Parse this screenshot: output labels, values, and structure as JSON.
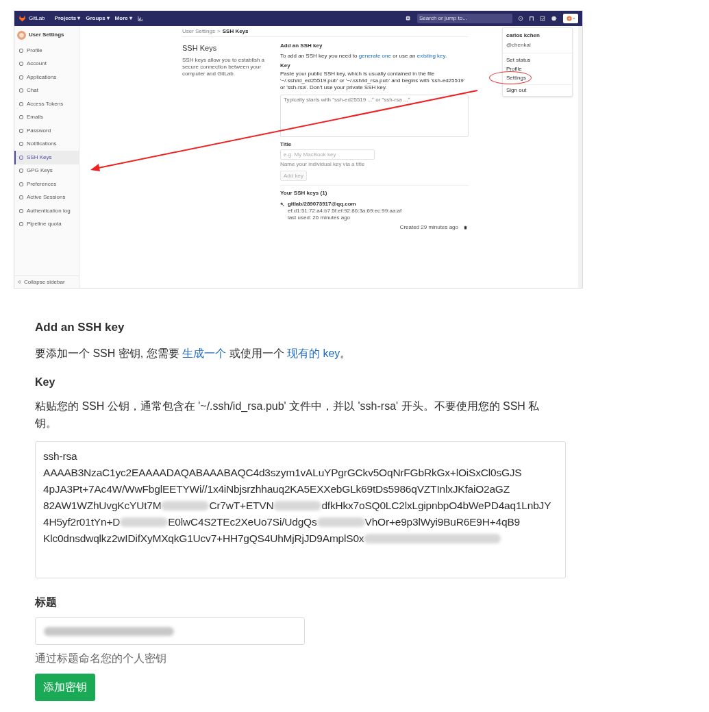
{
  "top_screenshot": {
    "navbar": {
      "brand": "GitLab",
      "menus": [
        {
          "label": "Projects",
          "caret": "▾"
        },
        {
          "label": "Groups",
          "caret": "▾"
        },
        {
          "label": "More",
          "caret": "▾"
        }
      ],
      "search": {
        "placeholder": "Search or jump to..."
      }
    },
    "sidebar": {
      "header": "User Settings",
      "items": [
        {
          "label": "Profile",
          "selected": false
        },
        {
          "label": "Account",
          "selected": false
        },
        {
          "label": "Applications",
          "selected": false
        },
        {
          "label": "Chat",
          "selected": false
        },
        {
          "label": "Access Tokens",
          "selected": false
        },
        {
          "label": "Emails",
          "selected": false
        },
        {
          "label": "Password",
          "selected": false
        },
        {
          "label": "Notifications",
          "selected": false
        },
        {
          "label": "SSH Keys",
          "selected": true
        },
        {
          "label": "GPG Keys",
          "selected": false
        },
        {
          "label": "Preferences",
          "selected": false
        },
        {
          "label": "Active Sessions",
          "selected": false
        },
        {
          "label": "Authentication log",
          "selected": false
        },
        {
          "label": "Pipeline quota",
          "selected": false
        }
      ],
      "collapse": "Collapse sidebar"
    },
    "breadcrumb": [
      "User Settings",
      "SSH Keys"
    ],
    "breadcrumb_separator": ">",
    "page_title": "SSH Keys",
    "page_description": "SSH keys allow you to establish a secure connection between your computer and GitLab.",
    "form": {
      "heading": "Add an SSH key",
      "intro": [
        "To add an SSH key you need to ",
        "generate one",
        " or use an ",
        "existing key",
        "."
      ],
      "key_label": "Key",
      "key_help": "Paste your public SSH key, which is usually contained in the file '~/.ssh/id_ed25519.pub' or '~/.ssh/id_rsa.pub' and begins with 'ssh-ed25519' or 'ssh-rsa'. Don't use your private SSH key.",
      "key_placeholder": "Typically starts with \"ssh-ed25519 ...\" or \"ssh-rsa ...\"",
      "title_label": "Title",
      "title_placeholder": "e.g. My MacBook key",
      "title_help": "Name your individual key via a title",
      "button": "Add key"
    },
    "keys_heading": "Your SSH keys (1)",
    "keys": [
      {
        "name": "gitlab/289073917@qq.com",
        "fingerprint": "ef:d1:51:72:a4:b7:5f:ef:92:86:3a:69:ec:99:aa:af",
        "last_used": "last used: 26 minutes ago",
        "created": "Created 29 minutes ago"
      }
    ],
    "user_menu": {
      "name": "carlos kchen",
      "handle": "@chenkai",
      "items": [
        {
          "label": "Set status",
          "circled": false
        },
        {
          "label": "Profile",
          "circled": false
        },
        {
          "label": "Settings",
          "circled": true
        }
      ],
      "sign_out": "Sign out"
    }
  },
  "bottom_form": {
    "heading": "Add an SSH key",
    "intro": [
      "要添加一个 SSH 密钥, 您需要 ",
      "生成一个",
      " 或使用一个 ",
      "现有的 key",
      "。"
    ],
    "key_label": "Key",
    "key_help": "粘贴您的 SSH 公钥，通常包含在 '~/.ssh/id_rsa.pub' 文件中，并以 'ssh-rsa' 开头。不要使用您的 SSH 私钥。",
    "key_lines": [
      [
        {
          "kind": "text",
          "text": "ssh-rsa"
        }
      ],
      [
        {
          "kind": "text",
          "text": "AAAAB3NzaC1yc2EAAAADAQABAAABAQC4d3szym1vALuYPgrGCkv5OqNrFGbRkGx+lOiSxCl0sGJS"
        }
      ],
      [
        {
          "kind": "text",
          "text": "4pJA3Pt+7Ac4W/WwFbglEETYWi//1x4iNbjsrzhhauq2KA5EXXebGLk69tDs5986qVZTInlxJKfaiO2aGZ"
        }
      ],
      [
        {
          "kind": "text",
          "text": "82AW1WZhUvgKcYUt7M"
        },
        {
          "kind": "blur"
        },
        {
          "kind": "text",
          "text": "Cr7wT+ETVN"
        },
        {
          "kind": "blur"
        },
        {
          "kind": "text",
          "text": "dfkHkx7oSQ0LC2lxLgipnbpO4bWePD4aq1LnbJY"
        }
      ],
      [
        {
          "kind": "text",
          "text": "4H5yf2r01tYn+D"
        },
        {
          "kind": "blur"
        },
        {
          "kind": "text",
          "text": "E0lwC4S2TEc2XeUo7Si/UdgQs"
        },
        {
          "kind": "blur"
        },
        {
          "kind": "text",
          "text": "VhOr+e9p3lWyi9BuR6E9H+4qB9"
        }
      ],
      [
        {
          "kind": "text",
          "text": "Klc0dnsdwqlkz2wIDifXyMXqkG1Ucv7+HH7gQS4UhMjRjJD9AmplS0x"
        },
        {
          "kind": "blur"
        }
      ]
    ],
    "title_label": "标题",
    "title_value_blurred": true,
    "title_help": "通过标题命名您的个人密钥",
    "button": "添加密钥"
  }
}
